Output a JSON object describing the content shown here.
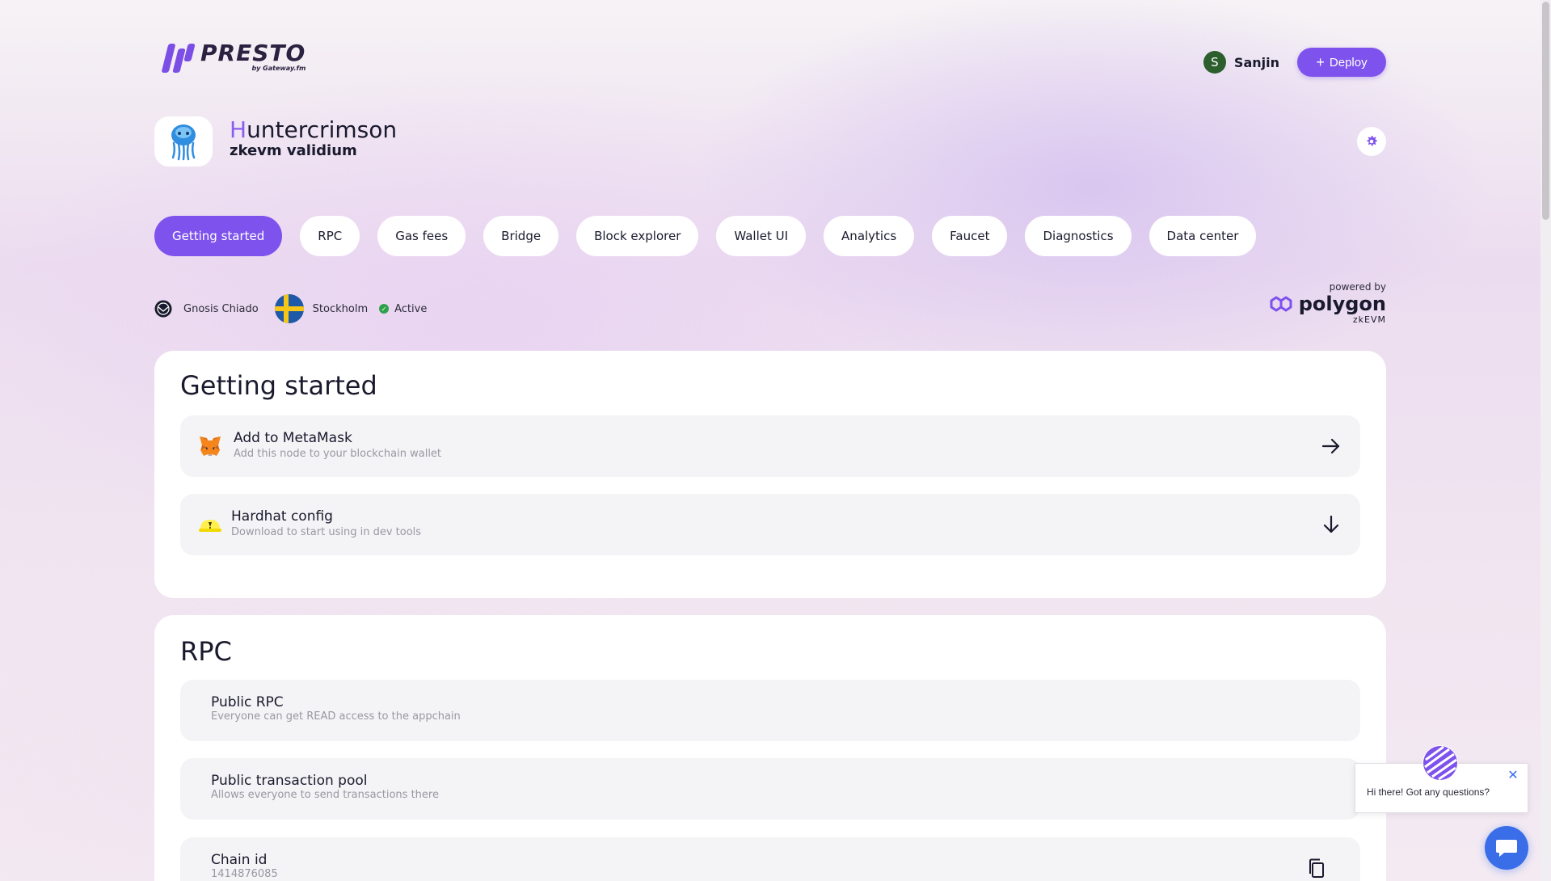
{
  "header": {
    "logo_text": "PRESTO",
    "logo_sub": "by Gateway.fm",
    "user_initial": "S",
    "user_name": "Sanjin",
    "deploy_label": "Deploy"
  },
  "project": {
    "title_first": "H",
    "title_rest": "untercrimson",
    "subtitle": "zkevm validium"
  },
  "tabs": [
    {
      "label": "Getting started",
      "active": true
    },
    {
      "label": "RPC"
    },
    {
      "label": "Gas fees"
    },
    {
      "label": "Bridge"
    },
    {
      "label": "Block explorer"
    },
    {
      "label": "Wallet UI"
    },
    {
      "label": "Analytics"
    },
    {
      "label": "Faucet"
    },
    {
      "label": "Diagnostics"
    },
    {
      "label": "Data center"
    }
  ],
  "status": {
    "network": "Gnosis Chiado",
    "location": "Stockholm",
    "state": "Active"
  },
  "powered": {
    "by": "powered by",
    "name": "polygon",
    "sub": "zkEVM"
  },
  "getting_started": {
    "title": "Getting started",
    "rows": [
      {
        "title": "Add to MetaMask",
        "desc": "Add this node to your blockchain wallet",
        "icon": "metamask-icon",
        "action": "arrow-right-icon"
      },
      {
        "title": "Hardhat config",
        "desc": "Download to start using in dev tools",
        "icon": "hardhat-icon",
        "action": "arrow-down-icon"
      }
    ]
  },
  "rpc": {
    "title": "RPC",
    "rows": [
      {
        "title": "Public RPC",
        "desc": "Everyone can get READ access to the appchain"
      },
      {
        "title": "Public transaction pool",
        "desc": "Allows everyone to send transactions there"
      },
      {
        "title": "Chain id",
        "desc": "1414876085",
        "action": "copy-icon"
      }
    ]
  },
  "chat": {
    "message": "Hi there! Got any questions?"
  },
  "colors": {
    "accent": "#7e52ec",
    "active_status": "#2ea24a",
    "chat": "#3a6ee8"
  }
}
